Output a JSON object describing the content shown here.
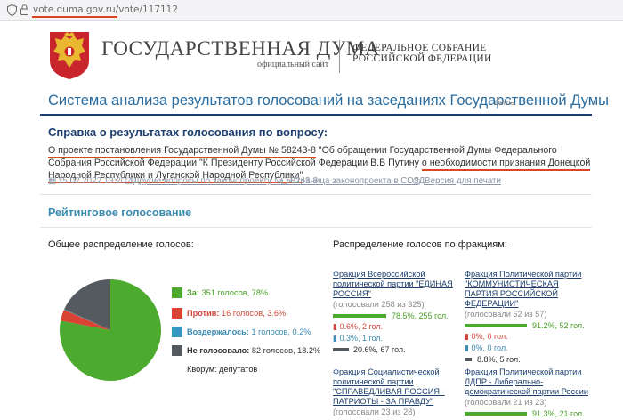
{
  "browser": {
    "url": "vote.duma.gov.ru/vote/117112"
  },
  "header": {
    "title": "ГОСУДАРСТВЕННАЯ ДУМА",
    "subtitle": "официальный сайт",
    "fs_line1": "ФЕДЕРАЛЬНОЕ СОБРАНИЕ",
    "fs_line2": "РОССИЙСКОЙ ФЕДЕРАЦИИ"
  },
  "system": {
    "title": "Система анализа результатов голосований на заседаниях Государственной Думы",
    "beta": "бета"
  },
  "reference": {
    "title": "Справка о результатах голосования по вопросу:",
    "desc_a": "О проекте постановления Государственной Думы № 58243-8",
    "desc_b": " \"Об обращении Государственной Думы Федерального Собрания Российской Федерации \"К Президенту Российской Федерации В.В Путину ",
    "desc_c": "о необходимости признания Донецкой Народной Республики и Луганской Народной Республики\""
  },
  "meta": {
    "date": "15.02.2022 13:20:41",
    "other_votes": "Другие вопросы по законопроекту № 58243-8",
    "bill_page": "Страница законопроекта в СОЗД",
    "print": "Версия для печати"
  },
  "rating_title": "Рейтинговое голосование",
  "overall": {
    "title": "Общее распределение голосов:",
    "colors": {
      "za": "#4caa2e",
      "protiv": "#d94333",
      "abst": "#3795c2",
      "none": "#555a60"
    },
    "items": [
      {
        "label": "За:",
        "text": " 351 голосов, 78%",
        "pct": 78
      },
      {
        "label": "Против:",
        "text": " 16 голосов, 3.6%",
        "pct": 3.6
      },
      {
        "label": "Воздержалось:",
        "text": " 1 голосов, 0.2%",
        "pct": 0.2
      },
      {
        "label": "Не голосовало:",
        "text": " 82 голосов, 18.2%",
        "pct": 18.2
      }
    ],
    "quorum": "Кворум:  депутатов"
  },
  "factions_title": "Распределение голосов по фракциям:",
  "factions": [
    {
      "name": "Фракция Всероссийской политической партии \"ЕДИНАЯ РОССИЯ\"",
      "voted": "(голосовали 258 из 325)",
      "za": "78.5%, 255 гол.",
      "za_pct": 78.5,
      "protiv": "0.6%, 2 гол.",
      "abst": "0.3%, 1 гол.",
      "none": "20.6%, 67 гол.",
      "none_pct": 20.6
    },
    {
      "name": "Фракция Политической партии \"КОММУНИСТИЧЕСКАЯ ПАРТИЯ РОССИЙСКОЙ ФЕДЕРАЦИИ\"",
      "voted": "(голосовали 52 из 57)",
      "za": "91.2%, 52 гол.",
      "za_pct": 91.2,
      "protiv": "0%, 0 гол.",
      "abst": "0%, 0 гол.",
      "none": "8.8%, 5 гол.",
      "none_pct": 8.8
    },
    {
      "name": "Фракция Социалистической политической партии \"СПРАВЕДЛИВАЯ РОССИЯ - ПАТРИОТЫ - ЗА ПРАВДУ\"",
      "voted": "(голосовали 23 из 28)"
    },
    {
      "name": "Фракция Политической партии ЛДПР - Либерально-демократической партии России",
      "voted": "(голосовали 21 из 23)",
      "za": "91.3%, 21 гол.",
      "za_pct": 91.3
    }
  ]
}
